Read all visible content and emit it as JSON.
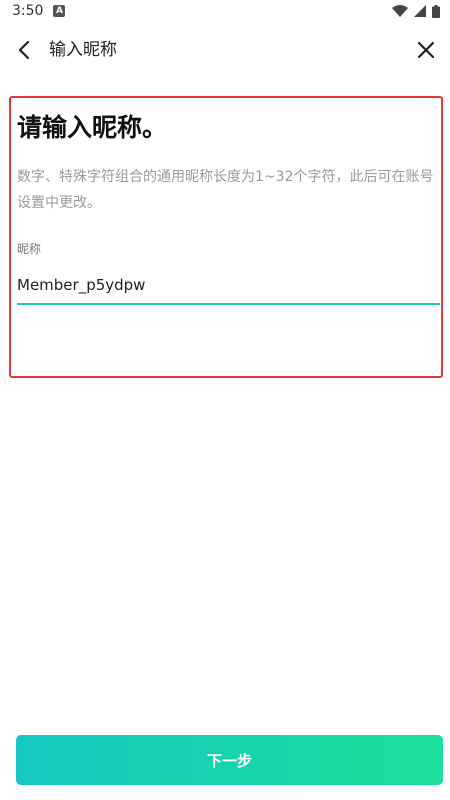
{
  "status_bar": {
    "time": "3:50",
    "notification_icon": "a-app-icon",
    "icons": [
      "wifi-icon",
      "signal-icon",
      "battery-icon"
    ]
  },
  "header": {
    "title": "输入昵称",
    "back_icon": "chevron-left-icon",
    "close_icon": "close-icon"
  },
  "main": {
    "title": "请输入昵称。",
    "description": "数字、特殊字符组合的通用昵称长度为1~32个字符，此后可在账号设置中更改。",
    "field_label": "昵称",
    "nickname_value": "Member_p5ydpw"
  },
  "footer": {
    "next_label": "下一步"
  },
  "colors": {
    "accent": "#1fc9b5",
    "highlight_border": "#e53935",
    "button_gradient_start": "#15c7c2",
    "button_gradient_end": "#1be09a"
  }
}
